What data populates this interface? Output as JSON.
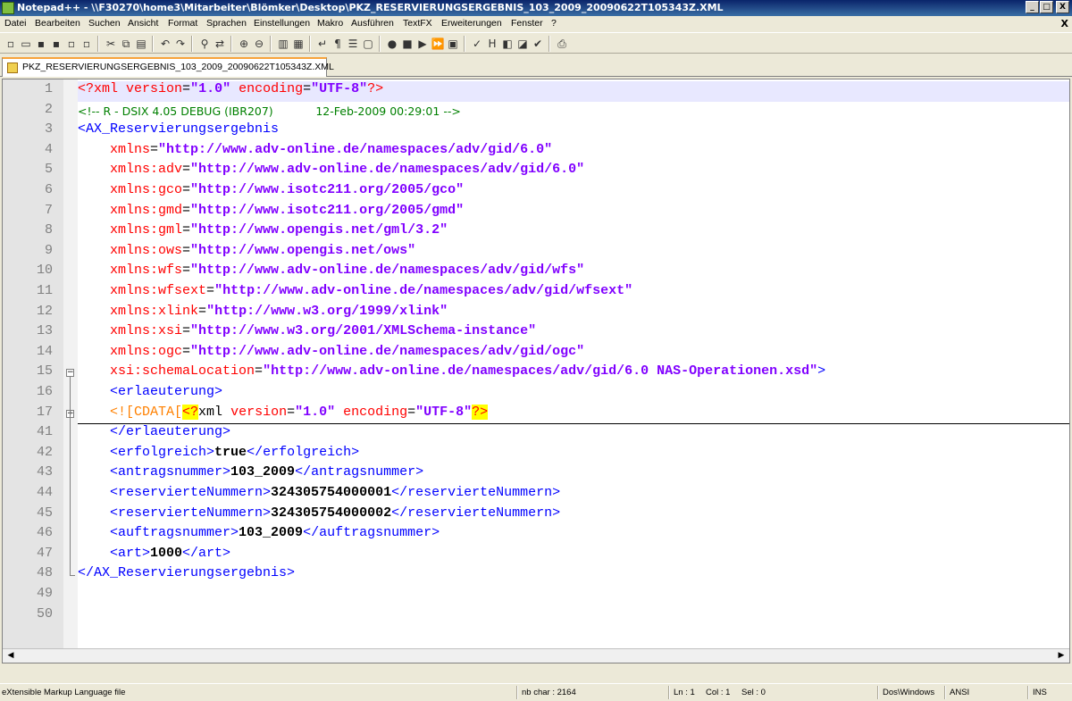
{
  "window": {
    "title": "Notepad++ - \\\\F30270\\home3\\Mitarbeiter\\Blömker\\Desktop\\PKZ_RESERVIERUNGSERGEBNIS_103_2009_20090622T105343Z.XML",
    "controls": [
      "_",
      "□",
      "X"
    ]
  },
  "menubar": {
    "items": [
      "Datei",
      "Bearbeiten",
      "Suchen",
      "Ansicht",
      "Format",
      "Sprachen",
      "Einstellungen",
      "Makro",
      "Ausführen",
      "TextFX",
      "Erweiterungen",
      "Fenster",
      "?"
    ],
    "close": "X"
  },
  "toolbar": {
    "buttons": [
      {
        "name": "new-file-icon",
        "glyph": "▫"
      },
      {
        "name": "open-file-icon",
        "glyph": "▭"
      },
      {
        "name": "save-icon",
        "glyph": "▪"
      },
      {
        "name": "save-all-icon",
        "glyph": "▪"
      },
      {
        "name": "close-icon",
        "glyph": "▫"
      },
      {
        "name": "close-all-icon",
        "glyph": "▫"
      },
      {
        "name": "cut-icon",
        "glyph": "✂"
      },
      {
        "name": "copy-icon",
        "glyph": "⧉"
      },
      {
        "name": "paste-icon",
        "glyph": "▤"
      },
      {
        "name": "undo-icon",
        "glyph": "↶"
      },
      {
        "name": "redo-icon",
        "glyph": "↷"
      },
      {
        "name": "find-icon",
        "glyph": "⚲"
      },
      {
        "name": "replace-icon",
        "glyph": "⇄"
      },
      {
        "name": "zoom-in-icon",
        "glyph": "⊕"
      },
      {
        "name": "zoom-out-icon",
        "glyph": "⊖"
      },
      {
        "name": "sync-vertical-icon",
        "glyph": "▥"
      },
      {
        "name": "sync-horizontal-icon",
        "glyph": "▦"
      },
      {
        "name": "word-wrap-icon",
        "glyph": "↵"
      },
      {
        "name": "show-all-chars-icon",
        "glyph": "¶"
      },
      {
        "name": "indent-guide-icon",
        "glyph": "☰"
      },
      {
        "name": "user-defined-lang-icon",
        "glyph": "▢"
      },
      {
        "name": "record-macro-icon",
        "glyph": "●"
      },
      {
        "name": "stop-macro-icon",
        "glyph": "■"
      },
      {
        "name": "play-macro-icon",
        "glyph": "▶"
      },
      {
        "name": "run-macro-multiple-icon",
        "glyph": "⏩"
      },
      {
        "name": "save-macro-icon",
        "glyph": "▣"
      },
      {
        "name": "spell-check-icon",
        "glyph": "✓"
      },
      {
        "name": "hex-icon",
        "glyph": "H"
      },
      {
        "name": "compare-icon",
        "glyph": "◧"
      },
      {
        "name": "sync-icon",
        "glyph": "◪"
      },
      {
        "name": "check-icon",
        "glyph": "✔"
      },
      {
        "name": "print-icon",
        "glyph": "⎙"
      }
    ]
  },
  "tab": {
    "label": "PKZ_RESERVIERUNGSERGEBNIS_103_2009_20090622T105343Z.XML"
  },
  "editor": {
    "lines": [
      {
        "num": "1",
        "html": "<span class='pi'>&lt;?xml</span> <span class='attr'>version</span>=<span class='val'>\"1.0\"</span> <span class='attr'>encoding</span>=<span class='val'>\"UTF-8\"</span><span class='pi'>?&gt;</span>",
        "hl": true
      },
      {
        "num": "2",
        "html": "&lt;!-- R - DSIX 4.05 DEBUG (IBR207)            12-Feb-2009 00:29:01 --&gt;",
        "comment": true
      },
      {
        "num": "3",
        "html": "<span class='tag'>&lt;AX_Reservierungsergebnis</span>"
      },
      {
        "num": "4",
        "html": "    <span class='attr'>xmlns</span>=<span class='val'>\"http://www.adv-online.de/namespaces/adv/gid/6.0\"</span>"
      },
      {
        "num": "5",
        "html": "    <span class='attr'>xmlns:adv</span>=<span class='val'>\"http://www.adv-online.de/namespaces/adv/gid/6.0\"</span>"
      },
      {
        "num": "6",
        "html": "    <span class='attr'>xmlns:gco</span>=<span class='val'>\"http://www.isotc211.org/2005/gco\"</span>"
      },
      {
        "num": "7",
        "html": "    <span class='attr'>xmlns:gmd</span>=<span class='val'>\"http://www.isotc211.org/2005/gmd\"</span>"
      },
      {
        "num": "8",
        "html": "    <span class='attr'>xmlns:gml</span>=<span class='val'>\"http://www.opengis.net/gml/3.2\"</span>"
      },
      {
        "num": "9",
        "html": "    <span class='attr'>xmlns:ows</span>=<span class='val'>\"http://www.opengis.net/ows\"</span>"
      },
      {
        "num": "10",
        "html": "    <span class='attr'>xmlns:wfs</span>=<span class='val'>\"http://www.adv-online.de/namespaces/adv/gid/wfs\"</span>"
      },
      {
        "num": "11",
        "html": "    <span class='attr'>xmlns:wfsext</span>=<span class='val'>\"http://www.adv-online.de/namespaces/adv/gid/wfsext\"</span>"
      },
      {
        "num": "12",
        "html": "    <span class='attr'>xmlns:xlink</span>=<span class='val'>\"http://www.w3.org/1999/xlink\"</span>"
      },
      {
        "num": "13",
        "html": "    <span class='attr'>xmlns:xsi</span>=<span class='val'>\"http://www.w3.org/2001/XMLSchema-instance\"</span>"
      },
      {
        "num": "14",
        "html": "    <span class='attr'>xmlns:ogc</span>=<span class='val'>\"http://www.adv-online.de/namespaces/adv/gid/ogc\"</span>"
      },
      {
        "num": "15",
        "html": "    <span class='attr'>xsi:schemaLocation</span>=<span class='val'>\"http://www.adv-online.de/namespaces/adv/gid/6.0 NAS-Operationen.xsd\"</span><span class='tag'>&gt;</span>",
        "fold": "minus"
      },
      {
        "num": "16",
        "html": "    <span class='tag'>&lt;erlaeuterung&gt;</span>"
      },
      {
        "num": "17",
        "html": "    <span class='cdata'>&lt;![CDATA[</span><span class='brace'>&lt;?</span>xml <span class='attr'>version</span>=<span class='val'>\"1.0\"</span> <span class='attr'>encoding</span>=<span class='val'>\"UTF-8\"</span><span class='brace'>?&gt;</span>",
        "fold": "plus",
        "marker": true
      },
      {
        "num": "41",
        "html": "    <span class='tag'>&lt;/erlaeuterung&gt;</span>"
      },
      {
        "num": "42",
        "html": "    <span class='tag'>&lt;erfolgreich&gt;</span><span class='txt'>true</span><span class='tag'>&lt;/erfolgreich&gt;</span>"
      },
      {
        "num": "43",
        "html": "    <span class='tag'>&lt;antragsnummer&gt;</span><span class='txt'>103_2009</span><span class='tag'>&lt;/antragsnummer&gt;</span>"
      },
      {
        "num": "44",
        "html": "    <span class='tag'>&lt;reservierteNummern&gt;</span><span class='txt'>324305754000001</span><span class='tag'>&lt;/reservierteNummern&gt;</span>"
      },
      {
        "num": "45",
        "html": "    <span class='tag'>&lt;reservierteNummern&gt;</span><span class='txt'>324305754000002</span><span class='tag'>&lt;/reservierteNummern&gt;</span>"
      },
      {
        "num": "46",
        "html": "    <span class='tag'>&lt;auftragsnummer&gt;</span><span class='txt'>103_2009</span><span class='tag'>&lt;/auftragsnummer&gt;</span>"
      },
      {
        "num": "47",
        "html": "    <span class='tag'>&lt;art&gt;</span><span class='txt'>1000</span><span class='tag'>&lt;/art&gt;</span>"
      },
      {
        "num": "48",
        "html": "<span class='tag'>&lt;/AX_Reservierungsergebnis&gt;</span>",
        "foldend": true
      },
      {
        "num": "49",
        "html": ""
      },
      {
        "num": "50",
        "html": ""
      }
    ]
  },
  "statusbar": {
    "file_type": "eXtensible Markup Language file",
    "nb_char": "nb char : 2164",
    "ln": "Ln : 1",
    "col": "Col : 1",
    "sel": "Sel : 0",
    "eol": "Dos\\Windows",
    "encoding": "ANSI",
    "mode": "INS"
  }
}
